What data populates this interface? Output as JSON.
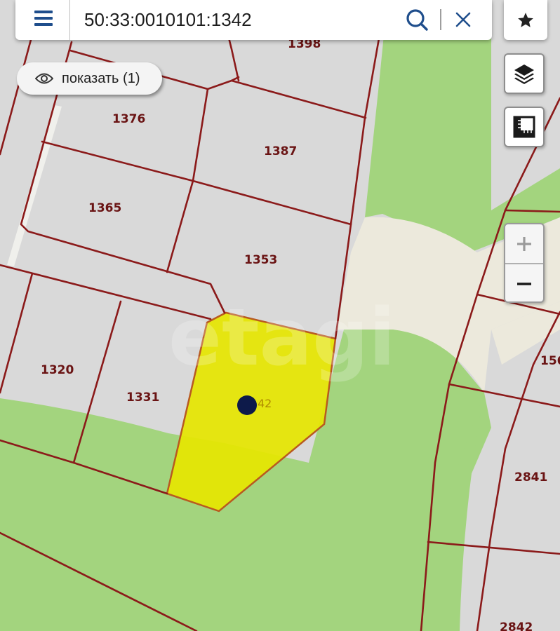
{
  "search": {
    "value": "50:33:0010101:1342",
    "placeholder": ""
  },
  "show_button": {
    "label": "показать (1)"
  },
  "icons": {
    "menu": "menu-icon",
    "search": "search-icon",
    "clear": "close-icon",
    "favorite": "star-icon",
    "visibility": "eye-icon",
    "layers": "layers-icon",
    "measure": "ruler-icon",
    "zoom_in": "plus-icon",
    "zoom_out": "minus-icon"
  },
  "colors": {
    "accent": "#1f4e8c",
    "boundary": "#8b1a1a",
    "selected_plot": "#e6e600",
    "vegetation": "#a3d47e",
    "road": "#ece9dc",
    "land": "#d9d9d9",
    "marker": "#0d1a4a"
  },
  "map": {
    "plots": [
      {
        "label": "1398"
      },
      {
        "label": "1376"
      },
      {
        "label": "1387"
      },
      {
        "label": "1365"
      },
      {
        "label": "1353"
      },
      {
        "label": "1320"
      },
      {
        "label": "1331"
      },
      {
        "label": "156"
      },
      {
        "label": "2841"
      },
      {
        "label": "2842"
      }
    ],
    "selected_plot_label": "42"
  },
  "watermark": "etagi"
}
